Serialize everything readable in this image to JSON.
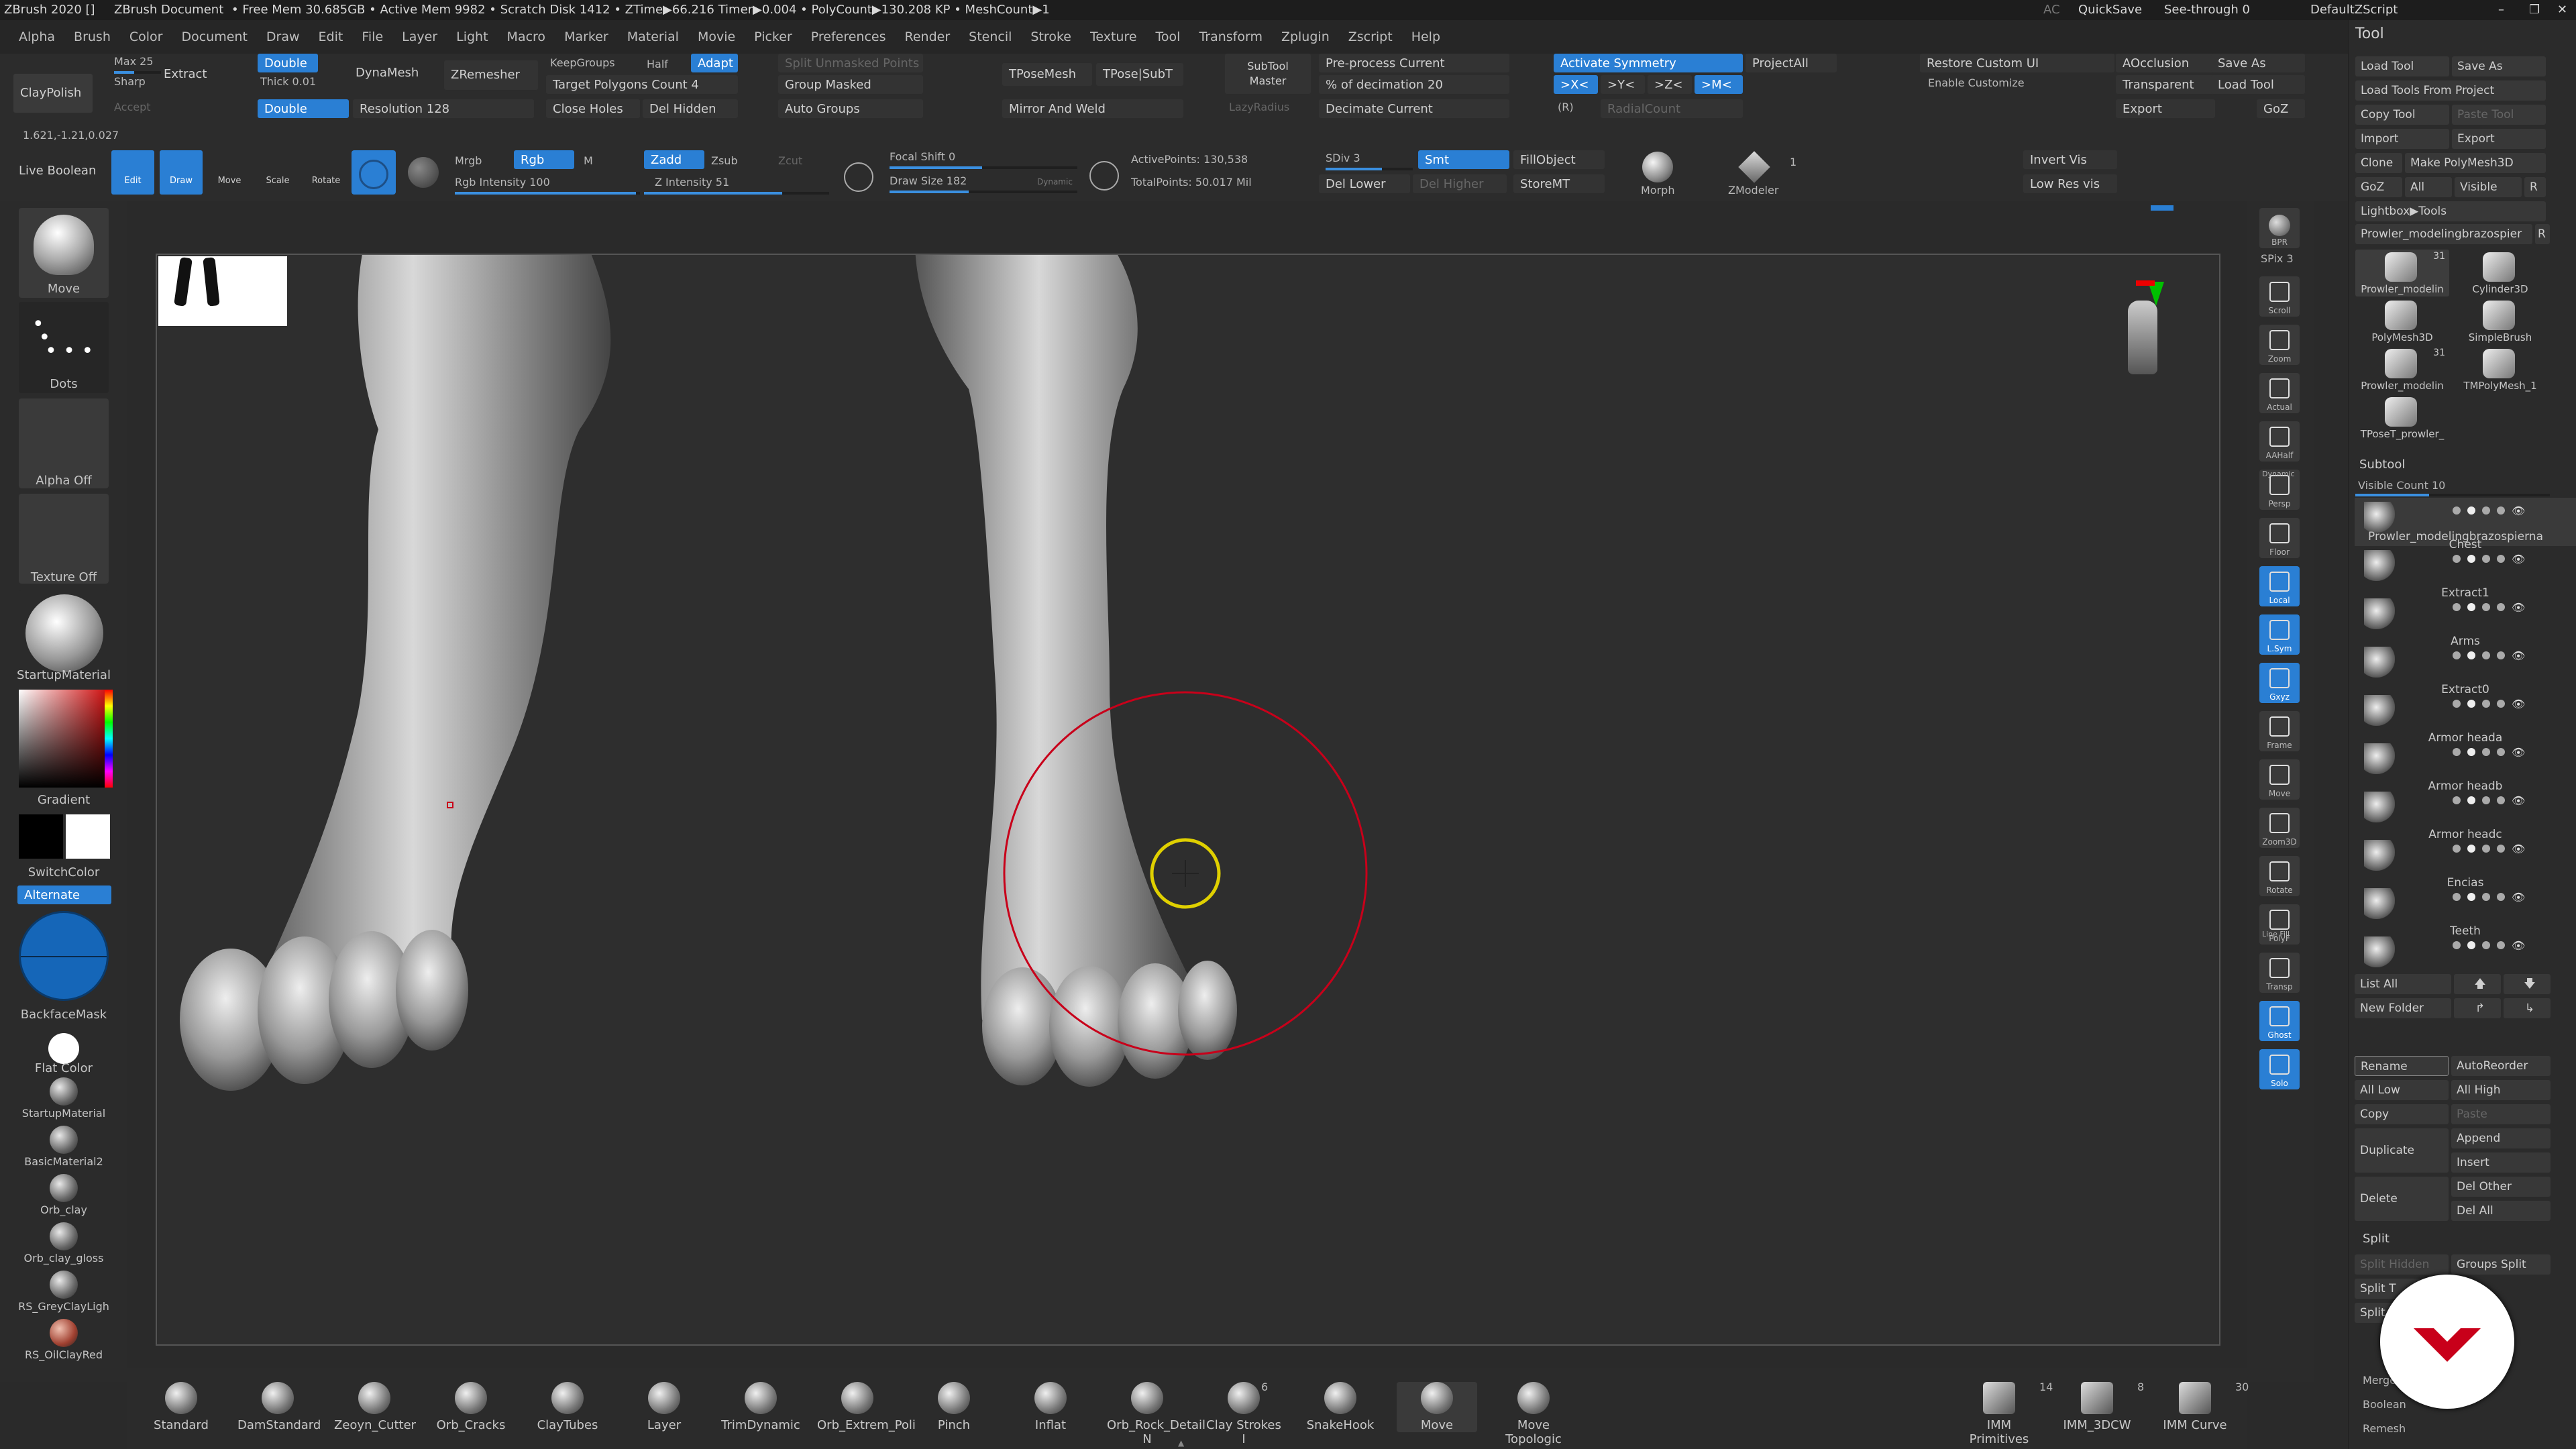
{
  "titlebar": {
    "app": "ZBrush 2020 []",
    "document": "ZBrush Document",
    "stats": "• Free Mem 30.685GB • Active Mem 9982 • Scratch Disk 1412 • ZTime▶66.216 Timer▶0.004 • PolyCount▶130.208 KP • MeshCount▶1",
    "ac": "AC",
    "quicksave": "QuickSave",
    "seethrough": "See-through 0",
    "script": "DefaultZScript"
  },
  "menu": [
    "Alpha",
    "Brush",
    "Color",
    "Document",
    "Draw",
    "Edit",
    "File",
    "Layer",
    "Light",
    "Macro",
    "Marker",
    "Material",
    "Movie",
    "Picker",
    "Preferences",
    "Render",
    "Stencil",
    "Stroke",
    "Texture",
    "Tool",
    "Transform",
    "Zplugin",
    "Zscript",
    "Help"
  ],
  "shelf": {
    "claypolish": "ClayPolish",
    "max": "Max 25",
    "sharp": "Sharp",
    "extract": "Extract",
    "accept": "Accept",
    "double1": "Double",
    "thick": "Thick 0.01",
    "double2": "Double",
    "dynamesh": "DynaMesh",
    "resolution": "Resolution 128",
    "zremesher": "ZRemesher",
    "keepgroups": "KeepGroups",
    "half": "Half",
    "adapt": "Adapt",
    "target": "Target Polygons Count 4",
    "closeholes": "Close Holes",
    "delhidden": "Del Hidden",
    "splitunmasked": "Split Unmasked Points",
    "groupmasked": "Group Masked",
    "autogroups": "Auto Groups",
    "tposemesh": "TPoseMesh",
    "tposesubt": "TPose|SubT",
    "mirrorweld": "Mirror And Weld",
    "subtoolmaster": "SubTool Master",
    "lazyradius": "LazyRadius",
    "preprocess": "Pre-process Current",
    "decimation": "% of decimation 20",
    "decimate": "Decimate Current",
    "activatesym": "Activate Symmetry",
    "projectall": "ProjectAll",
    "symx": ">X<",
    "symy": ">Y<",
    "symz": ">Z<",
    "symm": ">M<",
    "symr": "(R)",
    "radialcount": "RadialCount",
    "restorecustom": "Restore Custom UI",
    "enablecustomize": "Enable Customize",
    "aocclusion": "AOcclusion",
    "transparent": "Transparent",
    "export": "Export",
    "saveas": "Save As",
    "loadtool": "Load Tool",
    "goz": "GoZ",
    "coords": "1.621,-1.21,0.027",
    "liveboolean": "Live Boolean",
    "edit": "Edit",
    "draw": "Draw",
    "move": "Move",
    "scale": "Scale",
    "rotate": "Rotate",
    "mrgb": "Mrgb",
    "rgb": "Rgb",
    "m": "M",
    "rgbintensity": "Rgb Intensity 100",
    "zadd": "Zadd",
    "zsub": "Zsub",
    "zcut": "Zcut",
    "zintensity": "Z Intensity 51",
    "focalshift": "Focal Shift 0",
    "drawsize": "Draw Size 182",
    "dynamic": "Dynamic",
    "activepoints": "ActivePoints: 130,538",
    "totalpoints": "TotalPoints: 50.017 Mil",
    "sdiv": "SDiv 3",
    "smt": "Smt",
    "fillobject": "FillObject",
    "dellower": "Del Lower",
    "delhigher": "Del Higher",
    "storemt": "StoreMT",
    "morph": "Morph",
    "zmodeler": "ZModeler",
    "zmodeler_count": "1",
    "invertvis": "Invert Vis",
    "lowresvis": "Low Res vis"
  },
  "left": {
    "move": "Move",
    "dots": "Dots",
    "alphaoff": "Alpha Off",
    "textureoff": "Texture Off",
    "startupmaterial": "StartupMaterial",
    "gradient": "Gradient",
    "switchcolor": "SwitchColor",
    "alternate": "Alternate",
    "backfacemask": "BackfaceMask",
    "flatcolor": "Flat Color",
    "materials": [
      "StartupMaterial",
      "BasicMaterial2",
      "Orb_clay",
      "Orb_clay_gloss",
      "RS_GreyClayLigh",
      "RS_OilClayRed"
    ]
  },
  "rightbar": {
    "bpr": "BPR",
    "spix": "SPix 3",
    "items": [
      "Scroll",
      "Zoom",
      "Actual",
      "AAHalf",
      "Persp",
      "Floor",
      "Local",
      "L.Sym",
      "Gxyz",
      "Frame",
      "Move",
      "Zoom3D",
      "Rotate",
      "PolyF",
      "Transp",
      "Ghost",
      "Solo"
    ],
    "dynamic": "Dynamic",
    "linefill": "Line Fill"
  },
  "bottom": {
    "brushes": [
      "Standard",
      "DamStandard",
      "Zeoyn_Cutter",
      "Orb_Cracks",
      "ClayTubes",
      "Layer",
      "TrimDynamic",
      "Orb_Extrem_Poli",
      "Pinch",
      "Inflat",
      "Orb_Rock_Detail N",
      "Clay Strokes I",
      "SnakeHook",
      "Move",
      "Move Topologic"
    ],
    "claystrokes_count": "6",
    "imm": [
      "IMM Primitives",
      "IMM_3DCW",
      "IMM Curve"
    ],
    "imm_counts": [
      "14",
      "8",
      "30"
    ]
  },
  "tool": {
    "title": "Tool",
    "loadtool": "Load Tool",
    "saveas": "Save As",
    "loadfromproject": "Load Tools From Project",
    "copytool": "Copy Tool",
    "pastetool": "Paste Tool",
    "import": "Import",
    "export": "Export",
    "clone": "Clone",
    "makepolymesh": "Make PolyMesh3D",
    "goz": "GoZ",
    "all": "All",
    "visible": "Visible",
    "r": "R",
    "lightbox": "Lightbox▶Tools",
    "current": "Prowler_modelingbrazospier",
    "current_r": "R",
    "tools": [
      {
        "name": "Prowler_modelin",
        "count": "31"
      },
      {
        "name": "Cylinder3D",
        "count": ""
      },
      {
        "name": "PolyMesh3D",
        "count": ""
      },
      {
        "name": "SimpleBrush",
        "count": ""
      },
      {
        "name": "Prowler_modelin",
        "count": "31"
      },
      {
        "name": "TMPolyMesh_1",
        "count": ""
      },
      {
        "name": "TPoseT_prowler_",
        "count": ""
      }
    ],
    "subtool": "Subtool",
    "visiblecount": "Visible Count 10",
    "subtools": [
      "Prowler_modelingbrazospierna",
      "Chest",
      "Extract1",
      "Arms",
      "Extract0",
      "Armor heada",
      "Armor headb",
      "Armor headc",
      "Encias",
      "Teeth"
    ],
    "listall": "List All",
    "newfolder": "New Folder",
    "rename": "Rename",
    "autoreorder": "AutoReorder",
    "alllow": "All Low",
    "allhigh": "All High",
    "copy": "Copy",
    "paste": "Paste",
    "duplicate": "Duplicate",
    "append": "Append",
    "insert": "Insert",
    "delete": "Delete",
    "delother": "Del Other",
    "delall": "Del All",
    "split": "Split",
    "splithidden": "Split Hidden",
    "groupssplit": "Groups Split",
    "splitt": "Split T",
    "splits": "Split",
    "merge": "Merge",
    "boolean": "Boolean",
    "remesh": "Remesh"
  },
  "colors": {
    "accent": "#2a7fd4",
    "panel": "#2b2b2b",
    "viewport": "#2e2e2e",
    "red": "#c8001a"
  }
}
